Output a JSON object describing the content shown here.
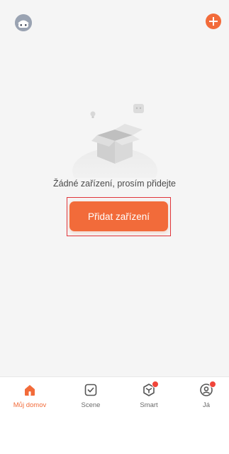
{
  "header": {
    "avatar_icon": "robot-avatar-icon",
    "add_icon": "plus-icon"
  },
  "empty_state": {
    "illustration": "empty-box-icon",
    "message": "Žádné zařízení, prosím přidejte",
    "add_button_label": "Přidat zařízení"
  },
  "tabs": [
    {
      "label": "Můj domov",
      "icon": "home-icon",
      "active": true,
      "badge": false
    },
    {
      "label": "Scene",
      "icon": "scene-checkbox-icon",
      "active": false,
      "badge": false
    },
    {
      "label": "Smart",
      "icon": "smart-cube-icon",
      "active": false,
      "badge": true
    },
    {
      "label": "Já",
      "icon": "profile-icon",
      "active": false,
      "badge": true
    }
  ],
  "colors": {
    "accent": "#f26b3a",
    "background": "#f5f5f5",
    "badge": "#f0453a",
    "highlight": "#e0353b"
  }
}
